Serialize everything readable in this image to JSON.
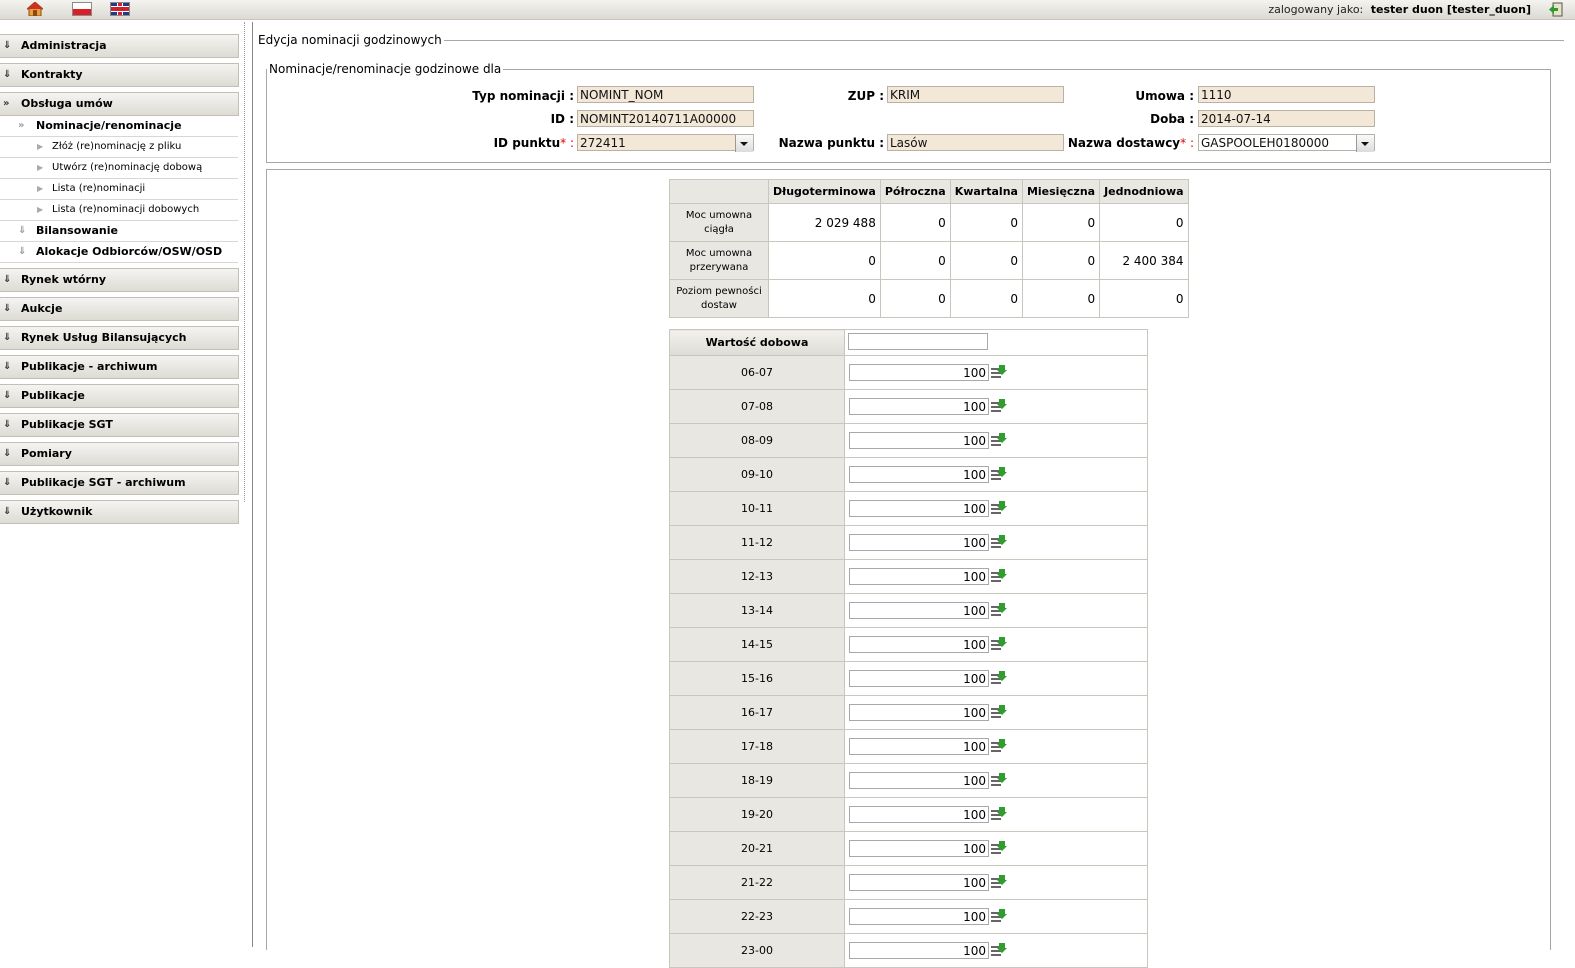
{
  "topbar": {
    "logged_label": "zalogowany jako:",
    "user": "tester duon [tester_duon]"
  },
  "sidebar": {
    "items": [
      {
        "label": "Administracja"
      },
      {
        "label": "Kontrakty"
      },
      {
        "label": "Obsługa umów"
      },
      {
        "label": "Rynek wtórny"
      },
      {
        "label": "Aukcje"
      },
      {
        "label": "Rynek Usług Bilansujących"
      },
      {
        "label": "Publikacje - archiwum"
      },
      {
        "label": "Publikacje"
      },
      {
        "label": "Publikacje SGT"
      },
      {
        "label": "Pomiary"
      },
      {
        "label": "Publikacje SGT - archiwum"
      },
      {
        "label": "Użytkownik"
      }
    ],
    "sub": {
      "nominacje": "Nominacje/renominacje",
      "zloz": "Złóż (re)nominację z pliku",
      "utworz": "Utwórz (re)nominację dobową",
      "lista": "Lista (re)nominacji",
      "lista_dob": "Lista (re)nominacji dobowych",
      "bilansowanie": "Bilansowanie",
      "alokacje": "Alokacje Odbiorców/OSW/OSD"
    }
  },
  "main": {
    "outer_legend": "Edycja nominacji godzinowych",
    "inner_legend": "Nominacje/renominacje godzinowe dla",
    "labels": {
      "typ": "Typ nominacji :",
      "id": "ID :",
      "id_punktu": "ID punktu",
      "zup": "ZUP :",
      "nazwa_punktu": "Nazwa punktu :",
      "umowa": "Umowa :",
      "doba": "Doba :",
      "nazwa_dostawcy": "Nazwa dostawcy"
    },
    "req_suffix": "* :",
    "values": {
      "typ": "NOMINT_NOM",
      "id": "NOMINT20140711A00000",
      "id_punktu": "272411",
      "zup": "KRIM",
      "nazwa_punktu": "Lasów",
      "umowa": "1110",
      "doba": "2014-07-14",
      "nazwa_dostawcy": "GASPOOLEH0180000"
    }
  },
  "summary": {
    "columns": [
      "Długoterminowa",
      "Półroczna",
      "Kwartalna",
      "Miesięczna",
      "Jednodniowa"
    ],
    "rows": [
      {
        "label": "Moc umowna ciągła",
        "values": [
          "2 029 488",
          "0",
          "0",
          "0",
          "0"
        ]
      },
      {
        "label": "Moc umowna przerywana",
        "values": [
          "0",
          "0",
          "0",
          "0",
          "2 400 384"
        ]
      },
      {
        "label": "Poziom pewności dostaw",
        "values": [
          "0",
          "0",
          "0",
          "0",
          "0"
        ]
      }
    ]
  },
  "hourly": {
    "header": "Wartość dobowa",
    "rows": [
      {
        "hour": "06-07",
        "value": "100"
      },
      {
        "hour": "07-08",
        "value": "100"
      },
      {
        "hour": "08-09",
        "value": "100"
      },
      {
        "hour": "09-10",
        "value": "100"
      },
      {
        "hour": "10-11",
        "value": "100"
      },
      {
        "hour": "11-12",
        "value": "100"
      },
      {
        "hour": "12-13",
        "value": "100"
      },
      {
        "hour": "13-14",
        "value": "100"
      },
      {
        "hour": "14-15",
        "value": "100"
      },
      {
        "hour": "15-16",
        "value": "100"
      },
      {
        "hour": "16-17",
        "value": "100"
      },
      {
        "hour": "17-18",
        "value": "100"
      },
      {
        "hour": "18-19",
        "value": "100"
      },
      {
        "hour": "19-20",
        "value": "100"
      },
      {
        "hour": "20-21",
        "value": "100"
      },
      {
        "hour": "21-22",
        "value": "100"
      },
      {
        "hour": "22-23",
        "value": "100"
      },
      {
        "hour": "23-00",
        "value": "100"
      }
    ]
  },
  "colors": {
    "readonly_bg": "#f3e8d8",
    "header_bg": "#e9e7e1",
    "required": "#dd0000"
  }
}
